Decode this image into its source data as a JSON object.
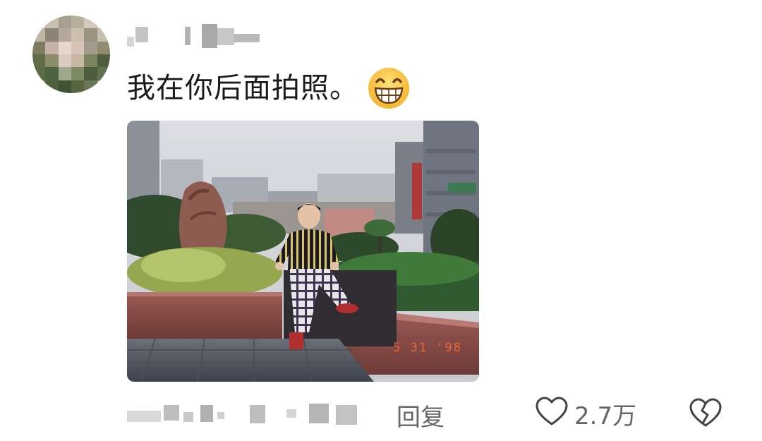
{
  "comment": {
    "text": "我在你后面拍照。",
    "emoji": "grinning-face-emoji"
  },
  "photo": {
    "date_stamp": "5 31 '98"
  },
  "footer": {
    "reply_label": "回复",
    "like_count": "2.7万",
    "like_icon": "heart-outline-icon",
    "dislike_icon": "broken-heart-icon"
  },
  "colors": {
    "text": "#1a1a1a",
    "muted": "#666666",
    "background": "#ffffff",
    "date_stamp": "#f06a3a"
  }
}
